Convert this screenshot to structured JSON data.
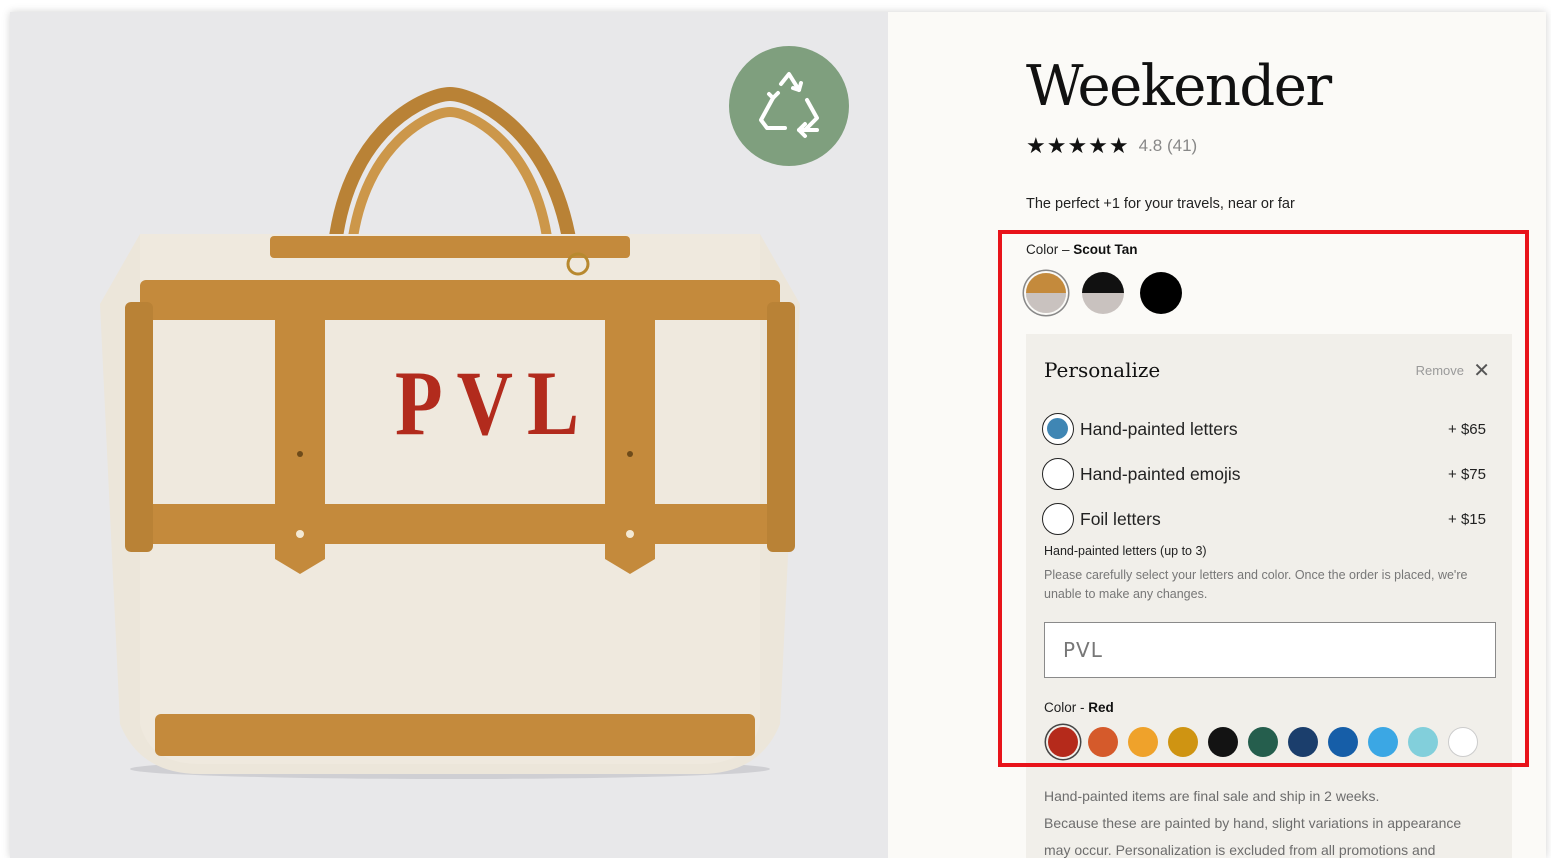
{
  "product": {
    "title": "Weekender",
    "stars": "★★★★★",
    "rating": "4.8 (41)",
    "tagline": "The perfect +1 for your travels, near or far",
    "monogram": "PVL"
  },
  "bag_color": {
    "label": "Color –",
    "selected": "Scout Tan",
    "swatches": [
      {
        "name": "scout-tan",
        "top": "#c48a3c",
        "bottom": "#c9c2bf"
      },
      {
        "name": "black-grey",
        "top": "#111111",
        "bottom": "#c9c2bf"
      },
      {
        "name": "black",
        "top": "#000000",
        "bottom": "#000000"
      }
    ]
  },
  "personalize": {
    "title": "Personalize",
    "remove": "Remove",
    "close_icon": "✕",
    "options": [
      {
        "label": "Hand-painted letters",
        "price": "+ $65",
        "selected": true
      },
      {
        "label": "Hand-painted emojis",
        "price": "+ $75",
        "selected": false
      },
      {
        "label": "Foil letters",
        "price": "+ $15",
        "selected": false
      }
    ],
    "letters_title": "Hand-painted letters (up to 3)",
    "letters_note": "Please carefully select your letters and color. Once the order is placed, we're unable to make any changes.",
    "letters_value": "PVL",
    "letter_color_label": "Color -",
    "letter_color_selected": "Red",
    "letter_colors": [
      "#b52a1b",
      "#d55a2b",
      "#efa22b",
      "#cf9412",
      "#131313",
      "#255e4d",
      "#1b3e6c",
      "#165ea8",
      "#3ba7e4",
      "#82cfdb",
      "#ffffff"
    ]
  },
  "notice": {
    "lines": [
      "Hand-painted items are final sale and ship in 2 weeks.",
      "Because these are painted by hand, slight variations in appearance",
      "may occur. Personalization is excluded from all promotions and"
    ]
  },
  "colors": {
    "accent_highlight": "#e8131a",
    "radio_selected": "#3f86b4",
    "recycle_badge": "#7f9f7e",
    "leather": "#c48a3c"
  }
}
